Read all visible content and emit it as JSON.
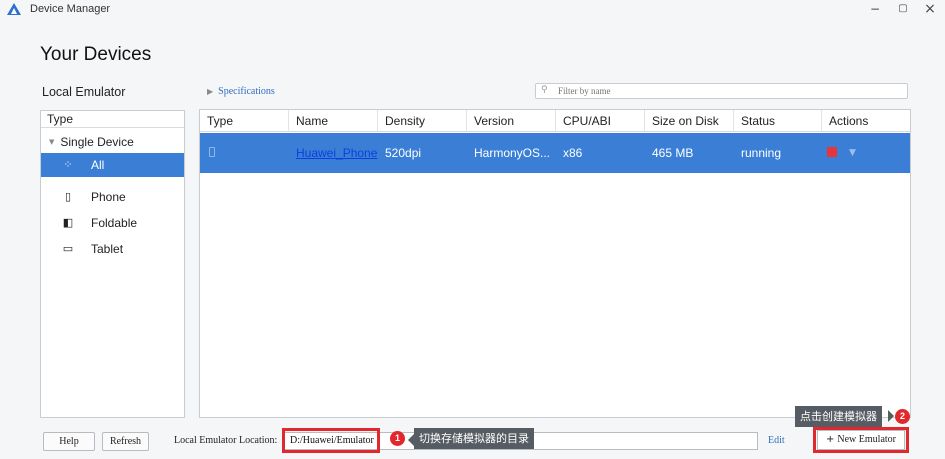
{
  "window": {
    "title": "Device Manager",
    "minimize": "−",
    "maximize": "▢",
    "close": "×",
    "accent": "#3a7fd5"
  },
  "page": {
    "title": "Your Devices",
    "section": "Local Emulator",
    "specifications": "Specifications",
    "filter_placeholder": "Filter by name"
  },
  "sidebar": {
    "header": "Type",
    "group": "Single Device",
    "items": [
      {
        "label": "All",
        "icon": "grid-icon",
        "selected": true
      },
      {
        "label": "Phone",
        "icon": "phone-icon",
        "selected": false
      },
      {
        "label": "Foldable",
        "icon": "foldable-icon",
        "selected": false
      },
      {
        "label": "Tablet",
        "icon": "tablet-icon",
        "selected": false
      }
    ]
  },
  "table": {
    "columns": [
      "Type",
      "Name",
      "Density",
      "Version",
      "CPU/ABI",
      "Size on Disk",
      "Status",
      "Actions"
    ],
    "rows": [
      {
        "type_icon": "phone-icon",
        "name": "Huawei_Phone",
        "density": "520dpi",
        "version": "HarmonyOS...",
        "cpu": "x86",
        "size": "465 MB",
        "status": "running",
        "actions": [
          "stop-icon",
          "chevron-down-icon"
        ]
      }
    ]
  },
  "footer": {
    "help": "Help",
    "refresh": "Refresh",
    "location_label": "Local Emulator Location:",
    "location_value": "D:/Huawei/Emulator",
    "edit": "Edit",
    "new_emulator": "New Emulator"
  },
  "annotations": [
    {
      "number": "1",
      "text": "切换存储模拟器的目录"
    },
    {
      "number": "2",
      "text": "点击创建模拟器"
    }
  ]
}
